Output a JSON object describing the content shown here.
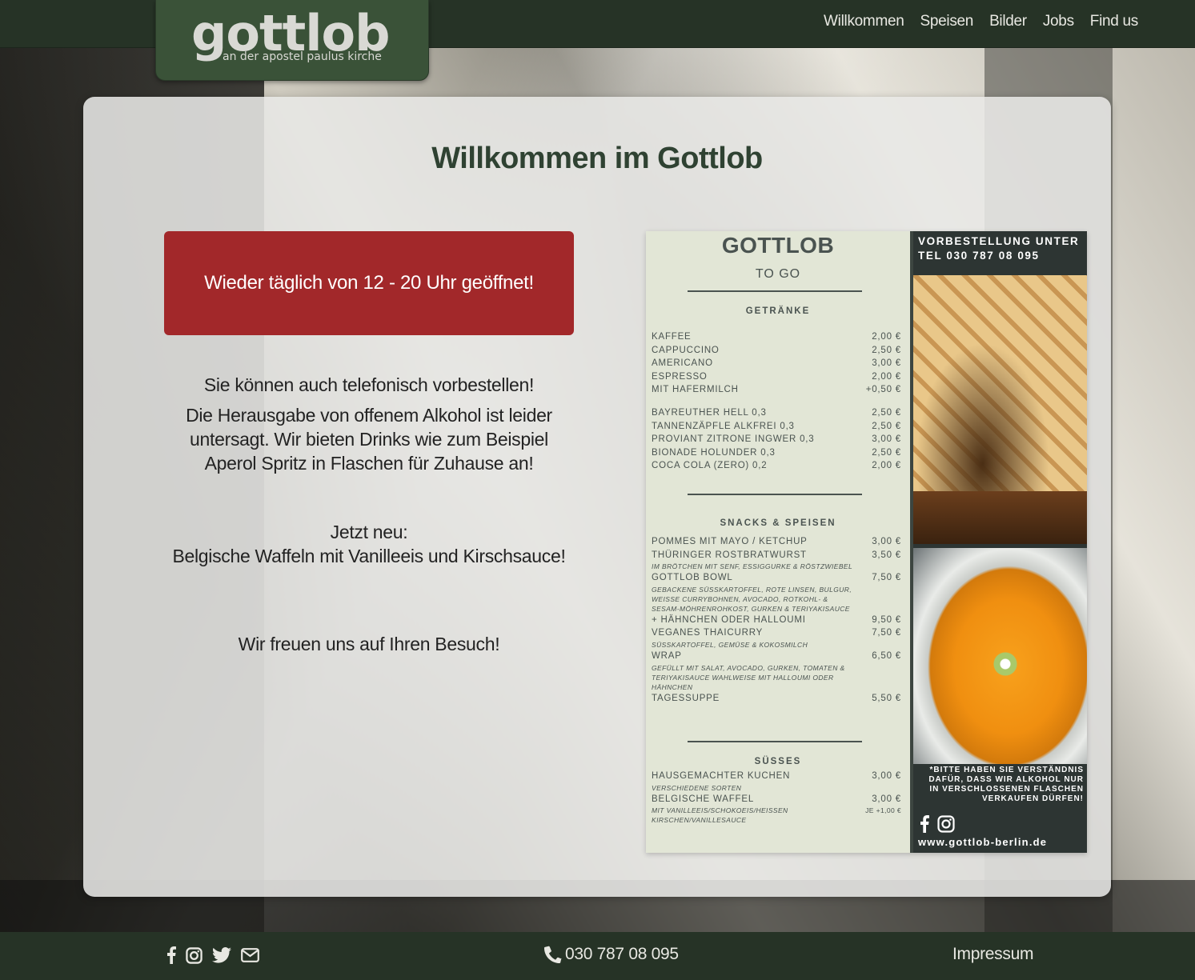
{
  "brand": {
    "logo_text": "gottlob",
    "logo_subtitle": "an der apostel paulus kirche"
  },
  "nav": {
    "items": [
      {
        "label": "Willkommen"
      },
      {
        "label": "Speisen"
      },
      {
        "label": "Bilder"
      },
      {
        "label": "Jobs"
      },
      {
        "label": "Find us"
      }
    ]
  },
  "main": {
    "title": "Willkommen im Gottlob",
    "notice": "Wieder täglich von 12 - 20 Uhr geöffnet!",
    "paragraphs": [
      "Sie können auch telefonisch vorbestellen!",
      "Die Herausgabe von offenem Alkohol ist leider untersagt. Wir bieten Drinks wie zum Beispiel Aperol Spritz in Flaschen für Zuhause an!",
      "Jetzt neu:",
      "Belgische Waffeln mit Vanilleeis und Kirschsauce!",
      "Wir freuen uns auf Ihren Besuch!"
    ]
  },
  "menu_image": {
    "title": "GOTTLOB",
    "subtitle": "TO GO",
    "sections": [
      {
        "heading": "GETRÄNKE",
        "items": [
          {
            "name": "KAFFEE",
            "price": "2,00 €"
          },
          {
            "name": "CAPPUCCINO",
            "price": "2,50 €"
          },
          {
            "name": "AMERICANO",
            "price": "3,00 €"
          },
          {
            "name": "ESPRESSO",
            "price": "2,00 €"
          },
          {
            "name": "MIT HAFERMILCH",
            "price": "+0,50 €"
          }
        ],
        "items2": [
          {
            "name": "BAYREUTHER HELL 0,3",
            "price": "2,50 €"
          },
          {
            "name": "TANNENZÄPFLE ALKFREI 0,3",
            "price": "2,50 €"
          },
          {
            "name": "PROVIANT ZITRONE INGWER 0,3",
            "price": "3,00 €"
          },
          {
            "name": "BIONADE HOLUNDER 0,3",
            "price": "2,50 €"
          },
          {
            "name": "COCA COLA (ZERO) 0,2",
            "price": "2,00 €"
          }
        ]
      },
      {
        "heading": "SNACKS & SPEISEN",
        "pommes": {
          "name": "POMMES MIT MAYO / KETCHUP",
          "price": "3,00 €"
        },
        "wurst": {
          "name": "THÜRINGER ROSTBRATWURST",
          "price": "3,50 €"
        },
        "wurst_note": "IM BRÖTCHEN MIT SENF, ESSIGGURKE & RÖSTZWIEBEL",
        "bowl": {
          "name": "GOTTLOB BOWL",
          "price": "7,50 €"
        },
        "bowl_note": "GEBACKENE SÜSSKARTOFFEL, ROTE LINSEN, BULGUR, WEISSE CURRYBOHNEN, AVOCADO, ROTKOHL- & SESAM-MÖHRENROHKOST, GURKEN & TERIYAKISAUCE",
        "bowl_extra": {
          "name": "+ HÄHNCHEN ODER HALLOUMI",
          "price": "9,50 €"
        },
        "curry": {
          "name": "VEGANES THAICURRY",
          "price": "7,50 €"
        },
        "curry_note": "SÜSSKARTOFFEL, GEMÜSE & KOKOSMILCH",
        "wrap": {
          "name": "WRAP",
          "price": "6,50 €"
        },
        "wrap_note": "GEFÜLLT MIT SALAT, AVOCADO, GURKEN, TOMATEN & TERIYAKISAUCE WAHLWEISE MIT HALLOUMI ODER HÄHNCHEN",
        "soup": {
          "name": "TAGESSUPPE",
          "price": "5,50 €"
        }
      },
      {
        "heading": "SÜSSES",
        "cake": {
          "name": "HAUSGEMACHTER KUCHEN",
          "price": "3,00 €"
        },
        "cake_note": "VERSCHIEDENE SORTEN",
        "waffle": {
          "name": "BELGISCHE WAFFEL",
          "price": "3,00 €"
        },
        "waffle_note": "MIT VANILLEEIS/SCHOKOEIS/HEISSEN KIRSCHEN/VANILLESAUCE",
        "waffle_extra": "JE +1,00 €"
      }
    ],
    "order_line1": "VORBESTELLUNG UNTER",
    "order_line2": "TEL 030 787 08 095",
    "alcohol_note": "*BITTE HABEN SIE VERSTÄNDNIS DAFÜR, DASS WIR ALKOHOL NUR IN VERSCHLOSSENEN FLASCHEN VERKAUFEN DÜRFEN!",
    "website": "www.gottlob-berlin.de",
    "icons": [
      "facebook-icon",
      "instagram-icon"
    ]
  },
  "footer": {
    "social_icons": [
      "facebook-icon",
      "instagram-icon",
      "twitter-icon",
      "mail-icon"
    ],
    "phone": "030 787 08 095",
    "phone_icon": "phone-icon",
    "impressum": "Impressum"
  },
  "colors": {
    "header_bg": "#263326",
    "logo_bg": "#3a5238",
    "title": "#2f4232",
    "notice_bg": "#a2282a"
  }
}
